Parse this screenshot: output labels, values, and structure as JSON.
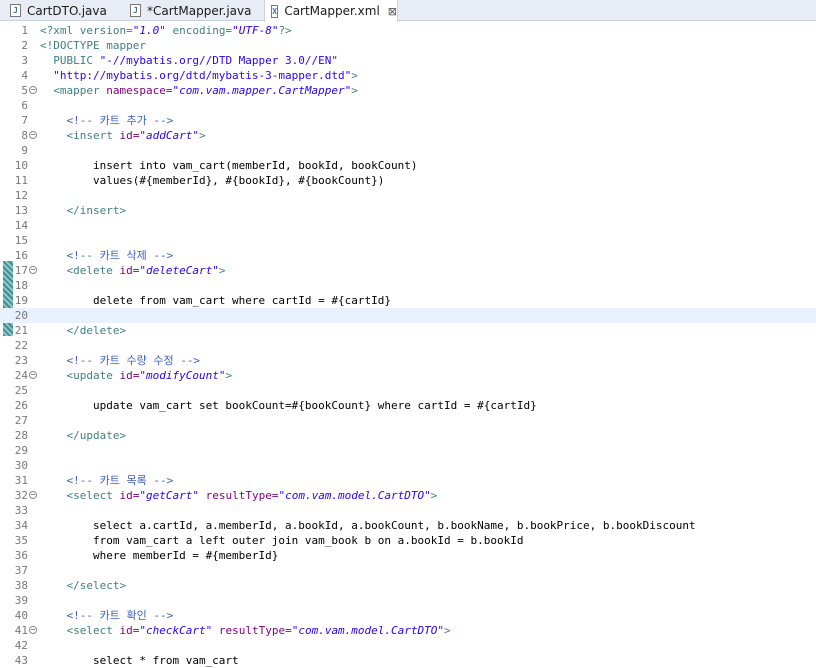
{
  "tabs": [
    {
      "label": "CartDTO.java",
      "icon": "java-file-icon",
      "active": false
    },
    {
      "label": "*CartMapper.java",
      "icon": "java-file-icon",
      "active": false
    },
    {
      "label": "CartMapper.xml",
      "icon": "xml-file-icon",
      "active": true,
      "close": "⊠"
    }
  ],
  "editor": {
    "current_line": 20,
    "lines": [
      {
        "n": "1",
        "t": [
          [
            "pi",
            "<?xml version="
          ],
          [
            "str",
            "\"1.0\""
          ],
          [
            "pi",
            " encoding="
          ],
          [
            "str",
            "\"UTF-8\""
          ],
          [
            "pi",
            "?>"
          ]
        ]
      },
      {
        "n": "2",
        "t": [
          [
            "pi",
            "<!DOCTYPE mapper"
          ]
        ]
      },
      {
        "n": "3",
        "t": [
          [
            "pi",
            "  PUBLIC "
          ],
          [
            "str2",
            "\"-//mybatis.org//DTD Mapper 3.0//EN\""
          ]
        ]
      },
      {
        "n": "4",
        "t": [
          [
            "str2",
            "  \"http://mybatis.org/dtd/mybatis-3-mapper.dtd\""
          ],
          [
            "pi",
            ">"
          ]
        ]
      },
      {
        "n": "5",
        "fold": true,
        "t": [
          [
            "tag",
            "  <mapper "
          ],
          [
            "attr",
            "namespace="
          ],
          [
            "str",
            "\"com.vam.mapper.CartMapper\""
          ],
          [
            "tag",
            ">"
          ]
        ]
      },
      {
        "n": "6",
        "t": []
      },
      {
        "n": "7",
        "t": [
          [
            "comment",
            "    <!-- 카트 추가 -->"
          ]
        ]
      },
      {
        "n": "8",
        "fold": true,
        "t": [
          [
            "tag",
            "    <insert "
          ],
          [
            "attr",
            "id="
          ],
          [
            "str",
            "\"addCart\""
          ],
          [
            "tag",
            ">"
          ]
        ]
      },
      {
        "n": "9",
        "t": []
      },
      {
        "n": "10",
        "t": [
          [
            "plain",
            "        insert into vam_cart(memberId, bookId, bookCount)"
          ]
        ]
      },
      {
        "n": "11",
        "t": [
          [
            "plain",
            "        values(#{memberId}, #{bookId}, #{bookCount})"
          ]
        ]
      },
      {
        "n": "12",
        "t": []
      },
      {
        "n": "13",
        "t": [
          [
            "tag",
            "    </insert>"
          ]
        ]
      },
      {
        "n": "14",
        "t": []
      },
      {
        "n": "15",
        "t": []
      },
      {
        "n": "16",
        "t": [
          [
            "comment",
            "    <!-- 카트 삭제 -->"
          ]
        ]
      },
      {
        "n": "17",
        "fold": true,
        "t": [
          [
            "tag",
            "    <delete "
          ],
          [
            "attr",
            "id="
          ],
          [
            "str",
            "\"deleteCart\""
          ],
          [
            "tag",
            ">"
          ]
        ]
      },
      {
        "n": "18",
        "t": []
      },
      {
        "n": "19",
        "t": [
          [
            "plain",
            "        delete from vam_cart where cartId = #{cartId}"
          ]
        ]
      },
      {
        "n": "20",
        "t": []
      },
      {
        "n": "21",
        "t": [
          [
            "tag",
            "    </delete>"
          ]
        ]
      },
      {
        "n": "22",
        "t": []
      },
      {
        "n": "23",
        "t": [
          [
            "comment",
            "    <!-- 카트 수량 수정 -->"
          ]
        ]
      },
      {
        "n": "24",
        "fold": true,
        "t": [
          [
            "tag",
            "    <update "
          ],
          [
            "attr",
            "id="
          ],
          [
            "str",
            "\"modifyCount\""
          ],
          [
            "tag",
            ">"
          ]
        ]
      },
      {
        "n": "25",
        "t": []
      },
      {
        "n": "26",
        "t": [
          [
            "plain",
            "        update vam_cart set bookCount=#{bookCount} where cartId = #{cartId}"
          ]
        ]
      },
      {
        "n": "27",
        "t": []
      },
      {
        "n": "28",
        "t": [
          [
            "tag",
            "    </update>"
          ]
        ]
      },
      {
        "n": "29",
        "t": []
      },
      {
        "n": "30",
        "t": []
      },
      {
        "n": "31",
        "t": [
          [
            "comment",
            "    <!-- 카트 목록 -->"
          ]
        ]
      },
      {
        "n": "32",
        "fold": true,
        "t": [
          [
            "tag",
            "    <select "
          ],
          [
            "attr",
            "id="
          ],
          [
            "str",
            "\"getCart\""
          ],
          [
            "attr",
            " resultType="
          ],
          [
            "str",
            "\"com.vam.model.CartDTO\""
          ],
          [
            "tag",
            ">"
          ]
        ]
      },
      {
        "n": "33",
        "t": []
      },
      {
        "n": "34",
        "t": [
          [
            "plain",
            "        select a.cartId, a.memberId, a.bookId, a.bookCount, b.bookName, b.bookPrice, b.bookDiscount"
          ]
        ]
      },
      {
        "n": "35",
        "t": [
          [
            "plain",
            "        from vam_cart a left outer join vam_book b on a.bookId = b.bookId"
          ]
        ]
      },
      {
        "n": "36",
        "t": [
          [
            "plain",
            "        where memberId = #{memberId}"
          ]
        ]
      },
      {
        "n": "37",
        "t": []
      },
      {
        "n": "38",
        "t": [
          [
            "tag",
            "    </select>"
          ]
        ]
      },
      {
        "n": "39",
        "t": []
      },
      {
        "n": "40",
        "t": [
          [
            "comment",
            "    <!-- 카트 확인 -->"
          ]
        ]
      },
      {
        "n": "41",
        "fold": true,
        "t": [
          [
            "tag",
            "    <select "
          ],
          [
            "attr",
            "id="
          ],
          [
            "str",
            "\"checkCart\""
          ],
          [
            "attr",
            " resultType="
          ],
          [
            "str",
            "\"com.vam.model.CartDTO\""
          ],
          [
            "tag",
            ">"
          ]
        ]
      },
      {
        "n": "42",
        "t": []
      },
      {
        "n": "43",
        "t": [
          [
            "plain",
            "        select * from vam_cart"
          ]
        ]
      }
    ]
  },
  "colors": {
    "pi": "#3f7f7f",
    "str": "#2a00ff",
    "str2": "#2a00ff",
    "tag": "#3f7f7f",
    "attr": "#7f007f",
    "comment": "#3f5fbf",
    "plain": "#000000"
  }
}
